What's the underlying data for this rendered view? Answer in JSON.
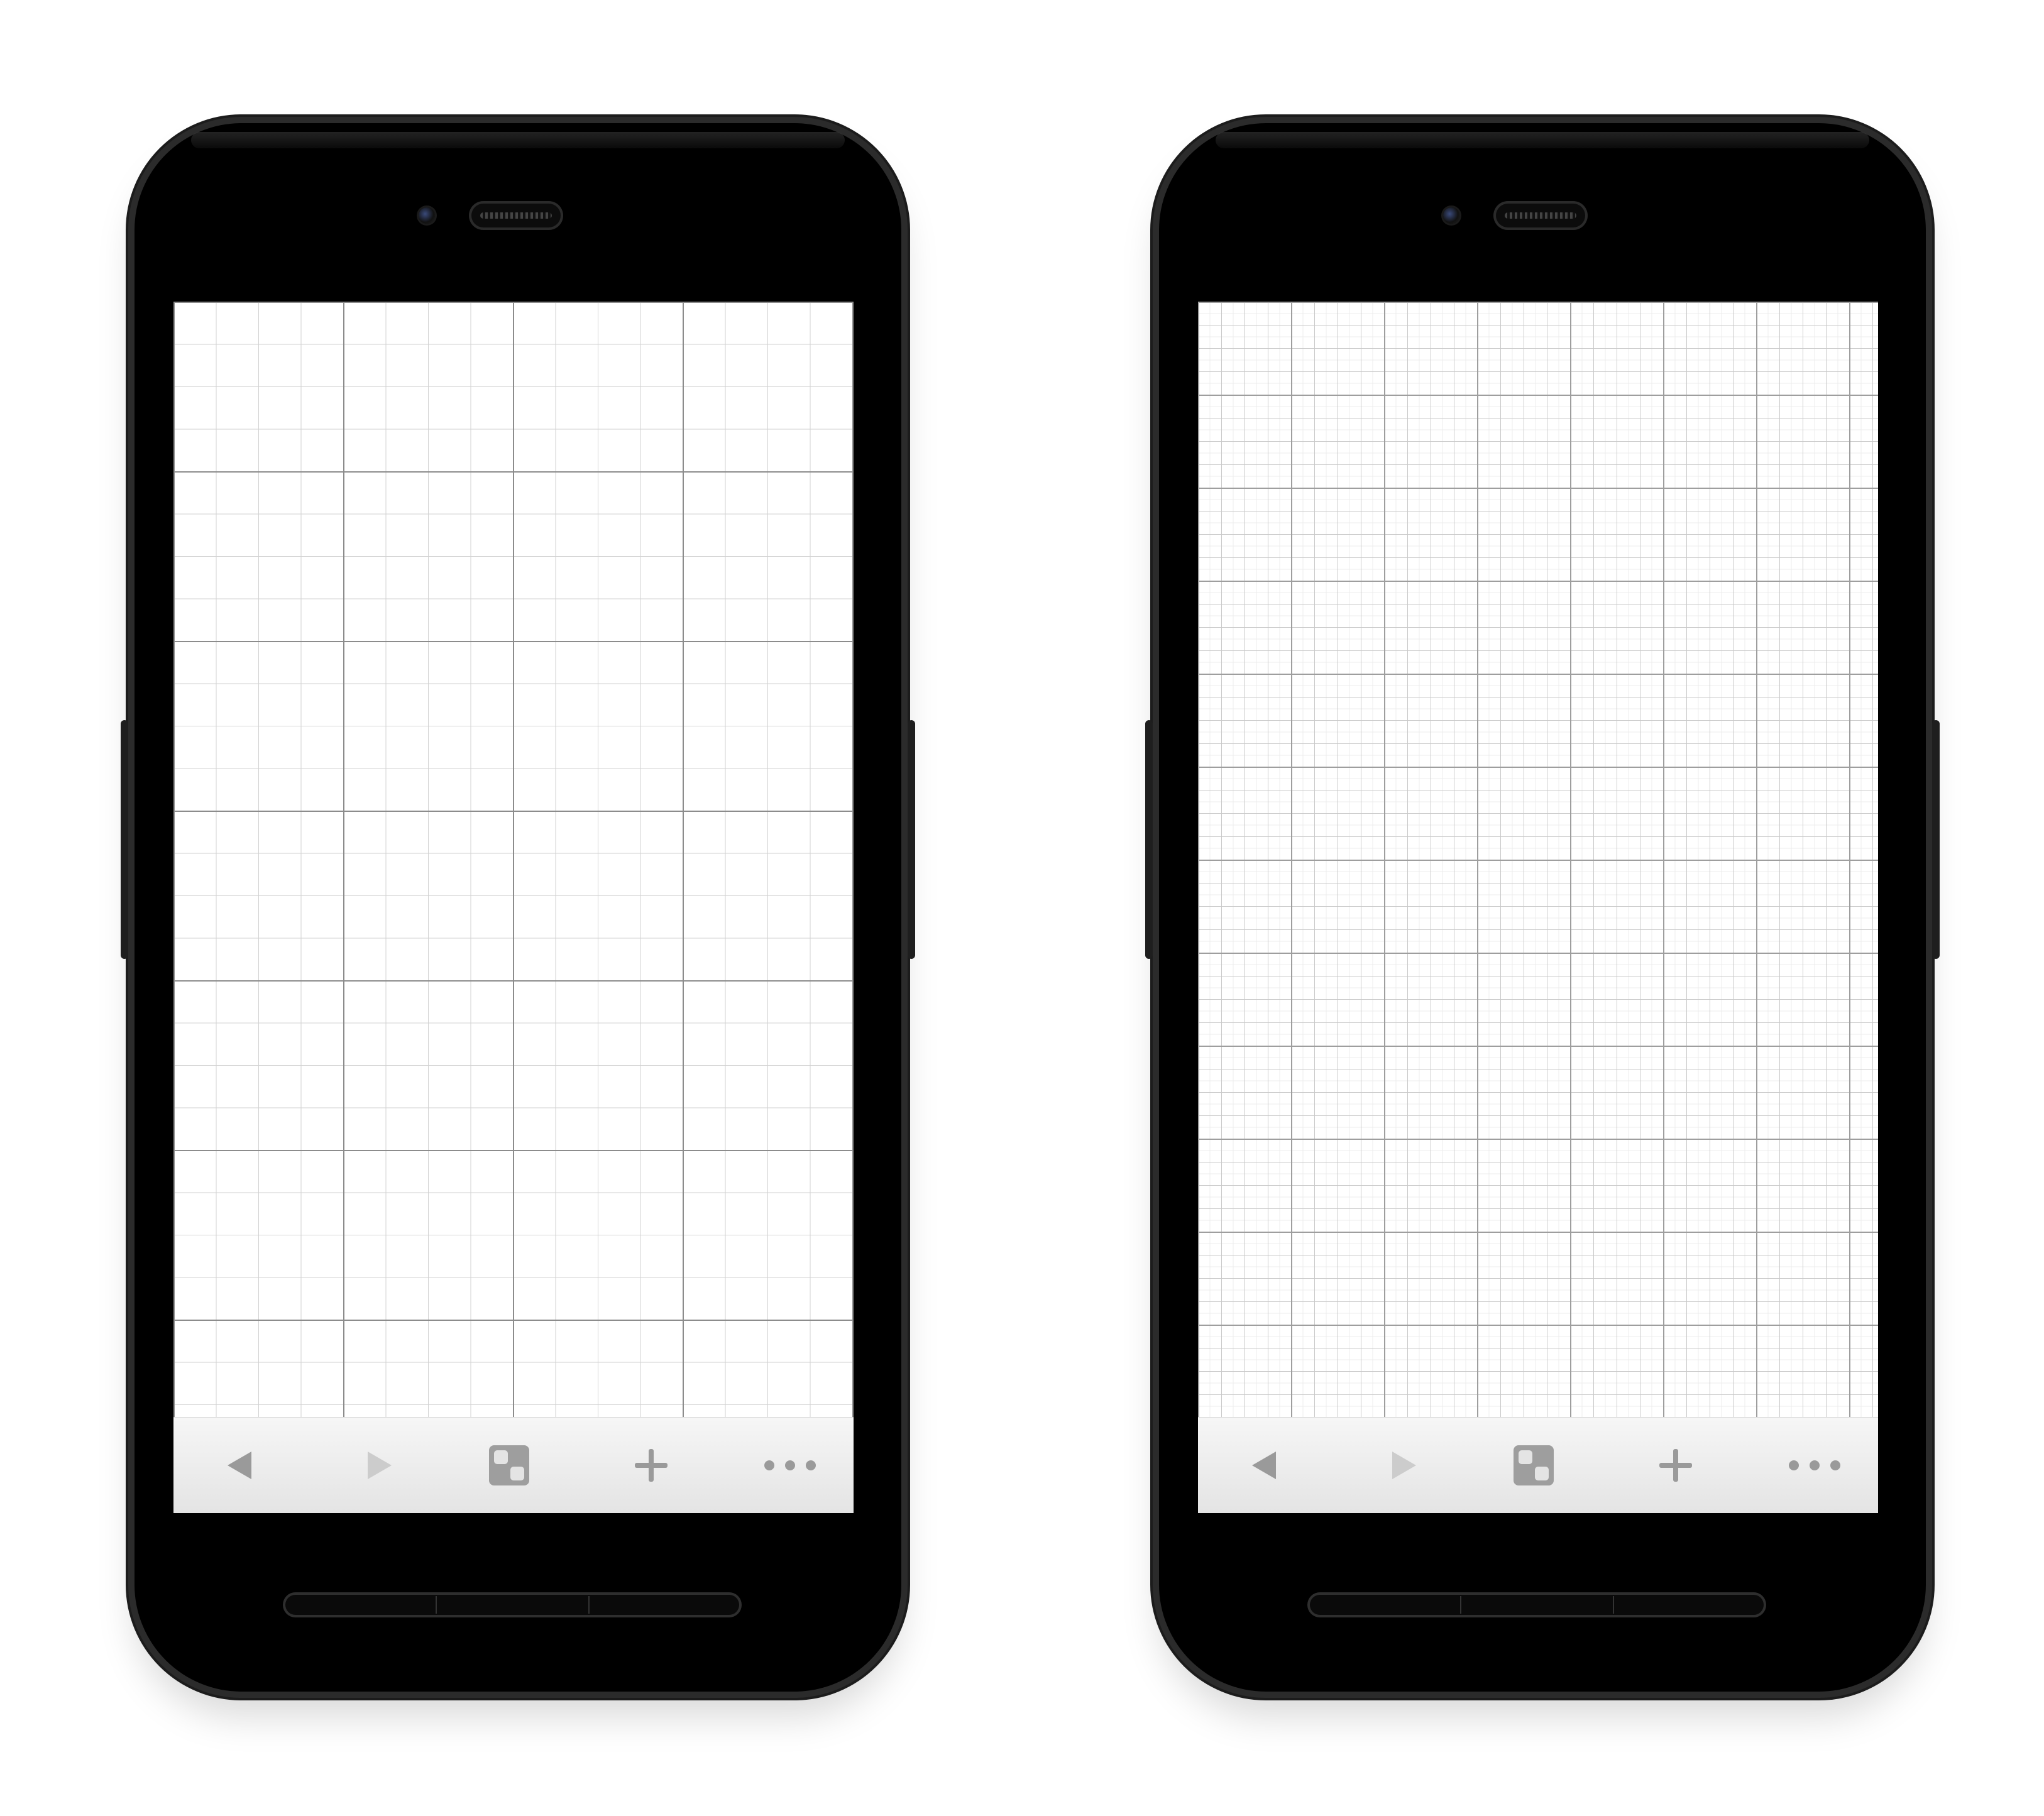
{
  "phones": [
    {
      "grid_style": "coarse",
      "toolbar": {
        "back_icon": "back-arrow-icon",
        "forward_icon": "forward-arrow-icon",
        "tabs_icon": "tabs-icon",
        "add_icon": "plus-icon",
        "more_icon": "more-dots-icon"
      }
    },
    {
      "grid_style": "fine",
      "toolbar": {
        "back_icon": "back-arrow-icon",
        "forward_icon": "forward-arrow-icon",
        "tabs_icon": "tabs-icon",
        "add_icon": "plus-icon",
        "more_icon": "more-dots-icon"
      }
    }
  ],
  "colors": {
    "body": "#000000",
    "frame": "#2b2b2b",
    "toolbar_bg": "#ececec",
    "icon_active": "#9a9a9a",
    "icon_disabled": "#cccccc",
    "grid_major": "#8c8c8c",
    "grid_minor": "#d2d2d2"
  }
}
